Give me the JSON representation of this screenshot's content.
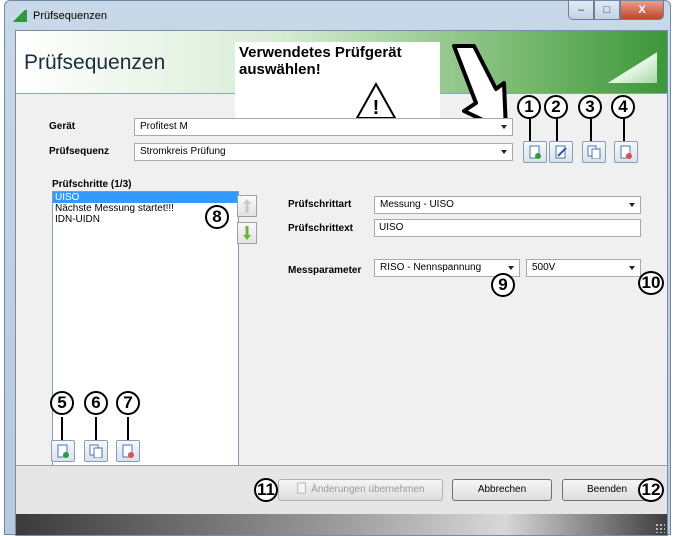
{
  "window": {
    "title": "Prüfsequenzen",
    "minimize_symbol": "–",
    "maximize_symbol": "□",
    "close_symbol": "X"
  },
  "header": {
    "title": "Prüfsequenzen"
  },
  "callout": {
    "text": "Verwendetes Prüfgerät\nauswählen!",
    "warning_symbol": "!"
  },
  "device": {
    "label": "Gerät",
    "value": "Profitest M"
  },
  "sequence": {
    "label": "Prüfsequenz",
    "value": "Stromkreis Prüfung"
  },
  "steps": {
    "title": "Prüfschritte (1/3)",
    "items": [
      "UISO",
      "Nächste Messung startet!!!",
      "IDN-UIDN"
    ]
  },
  "step_type": {
    "label": "Prüfschrittart",
    "value": "Messung - UISO"
  },
  "step_text": {
    "label": "Prüfschrittext",
    "value": "UISO"
  },
  "measure_params": {
    "label": "Messparameter",
    "param_value": "RISO - Nennspannung",
    "voltage_value": "500V"
  },
  "markers": [
    "1",
    "2",
    "3",
    "4",
    "5",
    "6",
    "7",
    "8",
    "9",
    "10",
    "11",
    "12"
  ],
  "buttons": {
    "apply": "Änderungen übernehmen",
    "cancel": "Abbrechen",
    "exit": "Beenden"
  },
  "colors": {
    "header_green": "#3c963a",
    "selection": "#3399ff",
    "add_icon_green": "#2e9b3a",
    "delete_icon_red": "#d9534f"
  },
  "icons": {
    "add_sequence": "document-add-icon",
    "edit_sequence": "document-edit-icon",
    "copy_sequence": "document-copy-icon",
    "delete_sequence": "document-delete-icon",
    "move_up": "arrow-up-icon",
    "move_down": "arrow-down-icon"
  }
}
